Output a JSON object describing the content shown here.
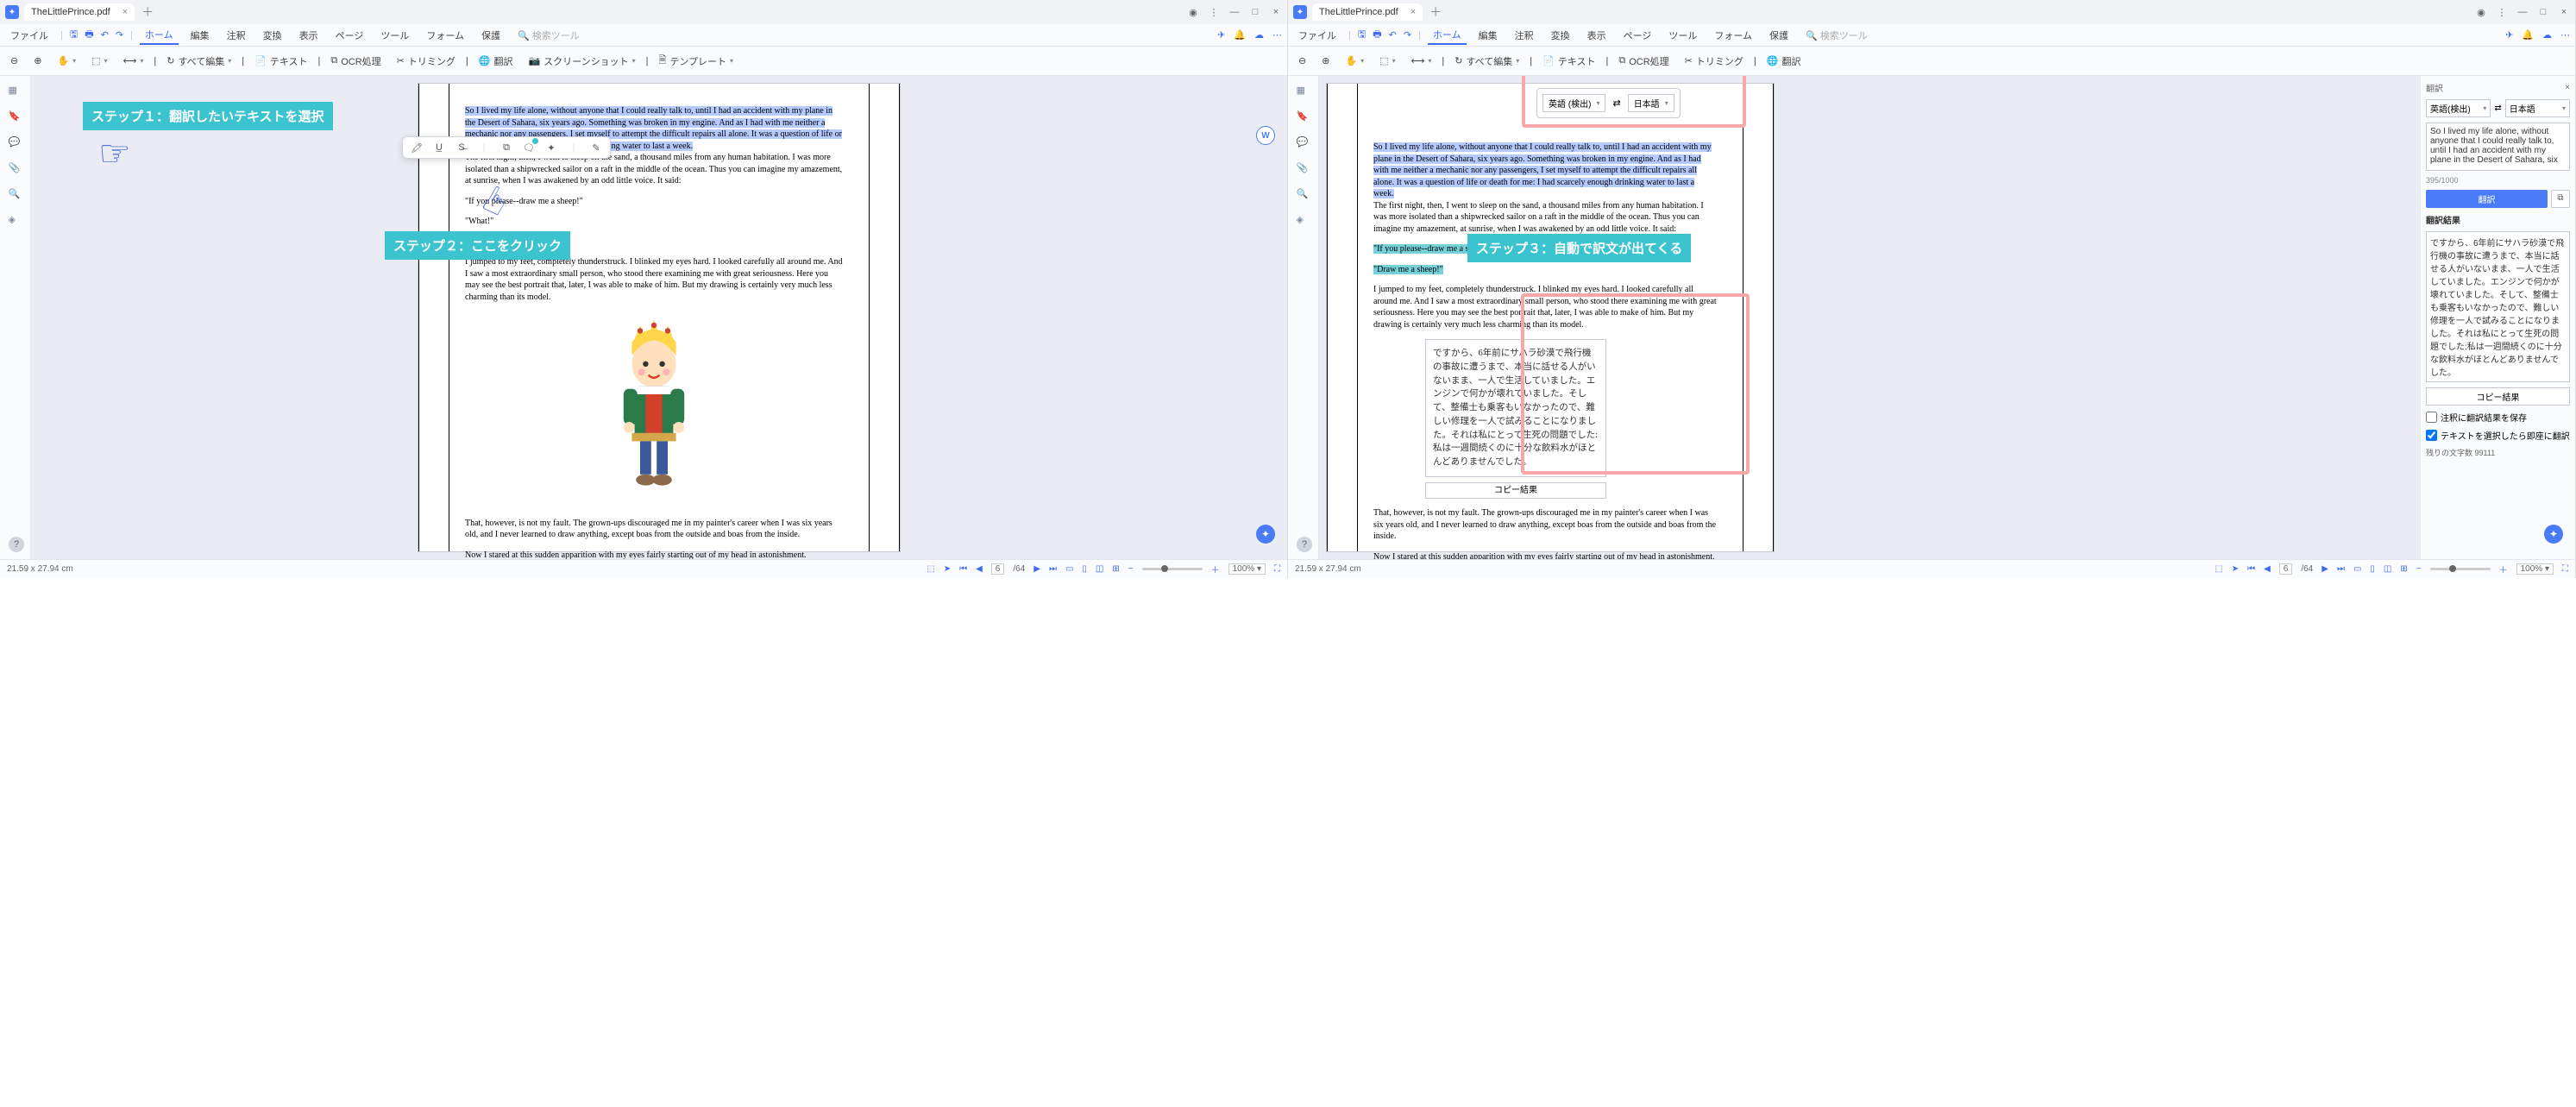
{
  "tab_title": "TheLittlePrince.pdf",
  "menu": {
    "file": "ファイル",
    "home": "ホーム",
    "edit": "編集",
    "comment": "注釈",
    "convert": "変換",
    "view": "表示",
    "page": "ページ",
    "tool": "ツール",
    "form": "フォーム",
    "protect": "保護",
    "search": "検索ツール"
  },
  "toolbar": {
    "edit_all": "すべて編集",
    "text": "テキスト",
    "ocr": "OCR処理",
    "trim": "トリミング",
    "translate": "翻訳",
    "screenshot": "スクリーンショット",
    "template": "テンプレート"
  },
  "callouts": {
    "step1": "ステップ１：翻訳したいテキストを選択",
    "step2": "ステップ２：ここをクリック",
    "step3": "ステップ３：自動で訳文が出てくる"
  },
  "float_tooltip": "翻訳",
  "doc": {
    "p1": "So I lived my life alone, without anyone that I could really talk to, until I had an accident with my plane in the Desert of Sahara, six years ago. Something was broken in my engine. And as I had with me neither a mechanic nor any passengers, I set myself to attempt the difficult repairs all alone. It was a question of life or death for me: I had scarcely enough drinking water to last a week.",
    "p2": "The first night, then, I went to sleep on the sand, a thousand miles from any human habitation. I was more isolated than a shipwrecked sailor on a raft in the middle of the ocean. Thus you can imagine my amazement, at sunrise, when I was awakened by an odd little voice. It said:",
    "p3": "\"If you please--draw me a sheep!\"",
    "p4": "\"What!\"",
    "p5": "\"Draw me a sheep!\"",
    "p6": "I jumped to my feet, completely thunderstruck. I blinked my eyes hard. I looked carefully all around me. And I saw a most extraordinary small person, who stood there examining me with great seriousness. Here you may see the best portrait that, later, I was able to make of him. But my drawing is certainly very much less charming than its model.",
    "p7": "That, however, is not my fault. The grown-ups discouraged me in my painter's career when I was six years old, and I never learned to draw anything, except boas from the outside and boas from the inside.",
    "p8": "Now I stared at this sudden apparition with my eyes fairly starting out of my head in astonishment. Remember, I had crashed in the desert a thousand miles from any inhabited region. And yet my little man seemed neither to be straying uncertainly among the sands, nor to be fainting from fatigue or hunger or thirst or fear. Nothing about him gave any suggestion of a child lost in the middle of the desert, a thousand miles from any human habitation. When at last I was able to speak, I said to him:"
  },
  "langpop": {
    "src": "英語 (検出)",
    "swap": "⇄",
    "dst": "日本語"
  },
  "panel": {
    "title": "翻訳",
    "src": "英語(検出)",
    "dst": "日本語",
    "swap": "⇄",
    "srctext": "So I lived my life alone, without anyone that I could really talk to, until I had an accident with my plane in the Desert of Sahara, six",
    "count": "395/1000",
    "btn": "翻訳",
    "result_label": "翻訳結果",
    "result": "ですから、6年前にサハラ砂漠で飛行機の事故に遭うまで、本当に話せる人がいないまま、一人で生活していました。エンジンで何かが壊れていました。そして、整備士も乗客もいなかったので、難しい修理を一人で試みることになりました。それは私にとって生死の問題でした:私は一週間続くのに十分な飲料水がほとんどありませんでした。",
    "copy": "コピー結果",
    "opt1": "注釈に翻訳結果を保存",
    "opt2": "テキストを選択したら即座に翻訳",
    "remaining_label": "残りの文字数",
    "remaining_val": "99111"
  },
  "inline_result": "ですから、6年前にサハラ砂漠で飛行機の事故に遭うまで、本当に話せる人がいないまま、一人で生活していました。エンジンで何かが壊れていました。そして、整備士も乗客もいなかったので、難しい修理を一人で試みることになりました。それは私にとって生死の問題でした:私は一週間続くのに十分な飲料水がほとんどありませんでした。",
  "inline_copy": "コピー結果",
  "statusbar": {
    "dim": "21.59 x 27.94 cm",
    "page": "6",
    "total": "/64",
    "zoom": "100%"
  }
}
